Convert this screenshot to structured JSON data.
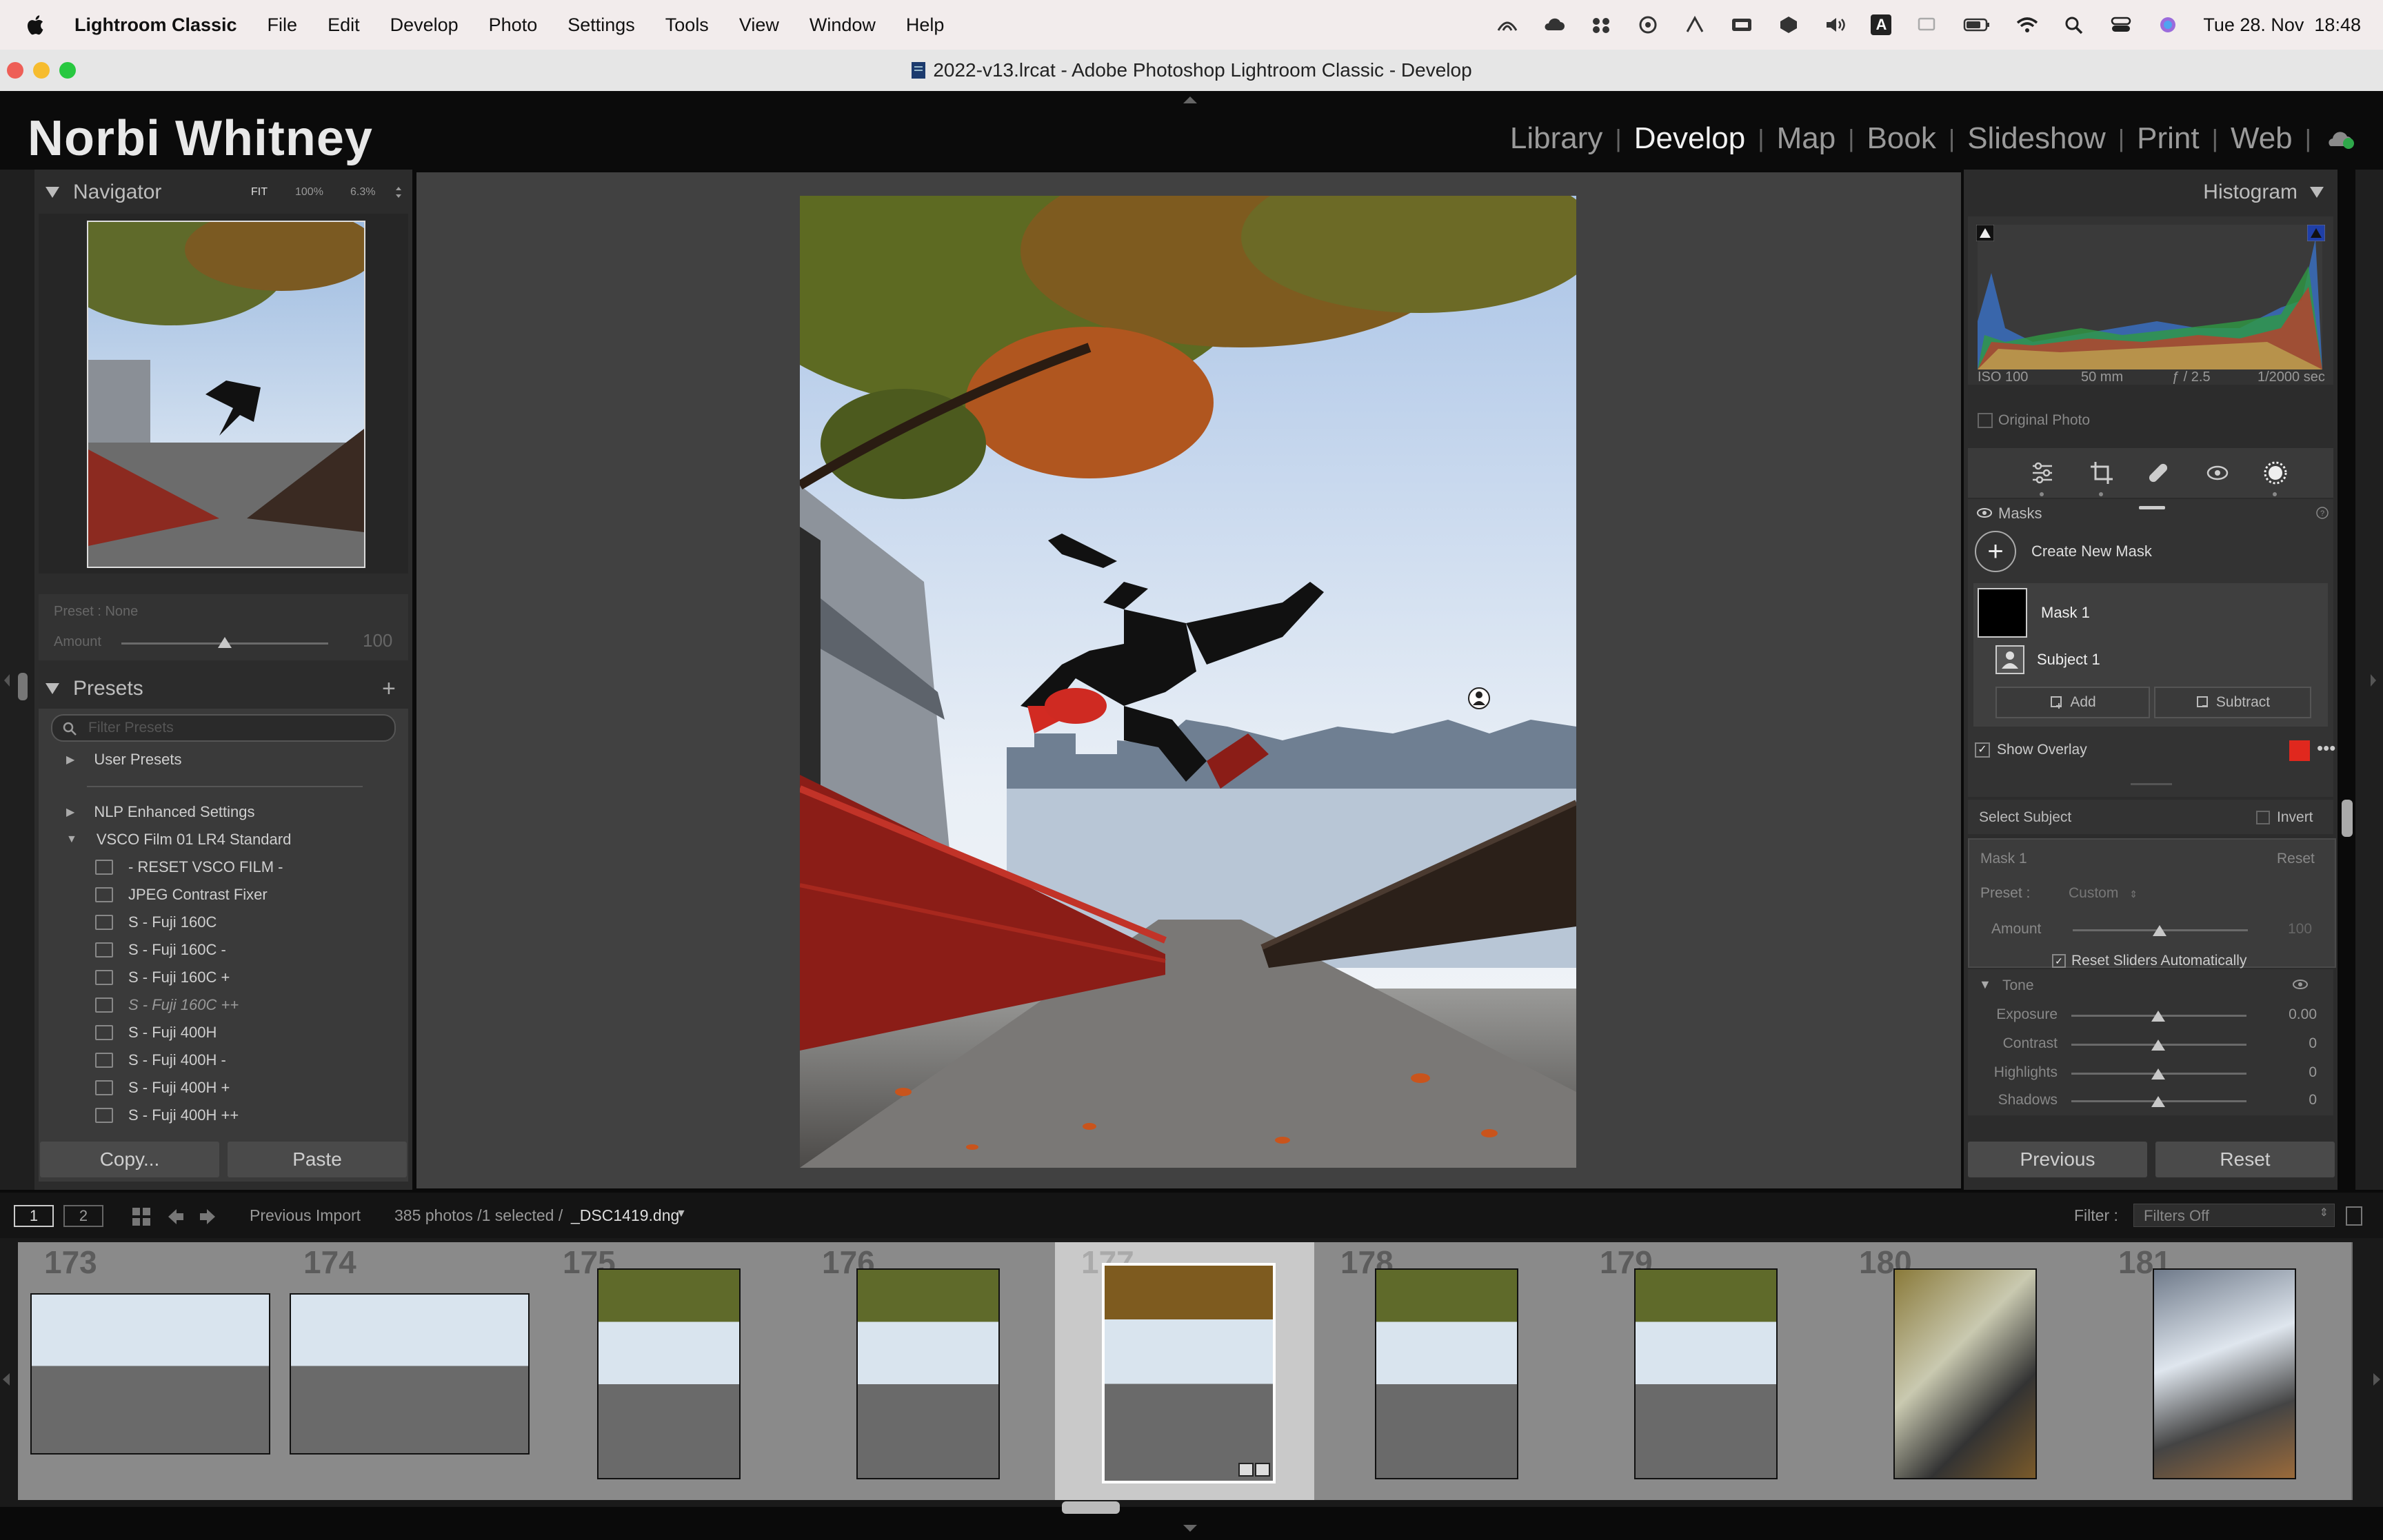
{
  "menubar": {
    "app_name": "Lightroom Classic",
    "items": [
      "File",
      "Edit",
      "Develop",
      "Photo",
      "Settings",
      "Tools",
      "View",
      "Window",
      "Help"
    ],
    "input_indicator": "A",
    "datetime": "Tue 28. Nov  18:48"
  },
  "window": {
    "title": "2022-v13.lrcat - Adobe Photoshop Lightroom Classic - Develop"
  },
  "identity": {
    "name": "Norbi Whitney"
  },
  "modules": {
    "items": [
      "Library",
      "Develop",
      "Map",
      "Book",
      "Slideshow",
      "Print",
      "Web"
    ],
    "active": "Develop"
  },
  "navigator": {
    "title": "Navigator",
    "zoom_options": [
      "FIT",
      "100%",
      "6.3%"
    ]
  },
  "preset_amount": {
    "preset_label": "Preset : None",
    "amount_label": "Amount",
    "amount_value": "100",
    "amount_level": 0.5
  },
  "presets": {
    "title": "Presets",
    "filter_placeholder": "Filter Presets",
    "groups": [
      "User Presets",
      "NLP Enhanced Settings",
      "VSCO Film 01 LR4 Standard"
    ],
    "items": [
      "- RESET VSCO FILM -",
      "JPEG Contrast Fixer",
      "S - Fuji 160C",
      "S - Fuji 160C -",
      "S - Fuji 160C +",
      "S - Fuji 160C ++",
      "S - Fuji 400H",
      "S - Fuji 400H -",
      "S - Fuji 400H +",
      "S - Fuji 400H ++"
    ]
  },
  "left_buttons": {
    "copy": "Copy...",
    "paste": "Paste"
  },
  "histogram": {
    "title": "Histogram",
    "iso": "ISO 100",
    "focal": "50 mm",
    "aperture": "ƒ / 2.5",
    "shutter": "1/2000 sec",
    "original_photo": "Original Photo"
  },
  "masks": {
    "title": "Masks",
    "create_new": "Create New Mask",
    "mask_name": "Mask 1",
    "component": "Subject 1",
    "add": "Add",
    "subtract": "Subtract",
    "show_overlay": "Show Overlay",
    "overlay_color": "#e0281e",
    "select_subject": "Select Subject",
    "invert": "Invert"
  },
  "mask_settings": {
    "mask_label": "Mask 1",
    "reset": "Reset",
    "preset_label": "Preset :",
    "preset_value": "Custom",
    "amount_label": "Amount",
    "amount_value": "100",
    "amount_level": 0.5,
    "reset_sliders": "Reset Sliders Automatically"
  },
  "tone": {
    "title": "Tone",
    "sliders": [
      {
        "label": "Exposure",
        "value": "0.00",
        "level": 0.5
      },
      {
        "label": "Contrast",
        "value": "0",
        "level": 0.5
      },
      {
        "label": "Highlights",
        "value": "0",
        "level": 0.5
      },
      {
        "label": "Shadows",
        "value": "0",
        "level": 0.5
      }
    ]
  },
  "right_buttons": {
    "previous": "Previous",
    "reset": "Reset"
  },
  "filmstrip_bar": {
    "screen1": "1",
    "screen2": "2",
    "source": "Previous Import",
    "count": "385 photos /1 selected /",
    "filename": "_DSC1419.dng",
    "filter_label": "Filter :",
    "filter_value": "Filters Off"
  },
  "filmstrip": {
    "frames": [
      "173",
      "174",
      "175",
      "176",
      "177",
      "178",
      "179",
      "180",
      "181"
    ],
    "selected": "177"
  },
  "colors": {
    "accent_red": "#e0281e",
    "panel": "#333333",
    "canvas": "#404040"
  }
}
